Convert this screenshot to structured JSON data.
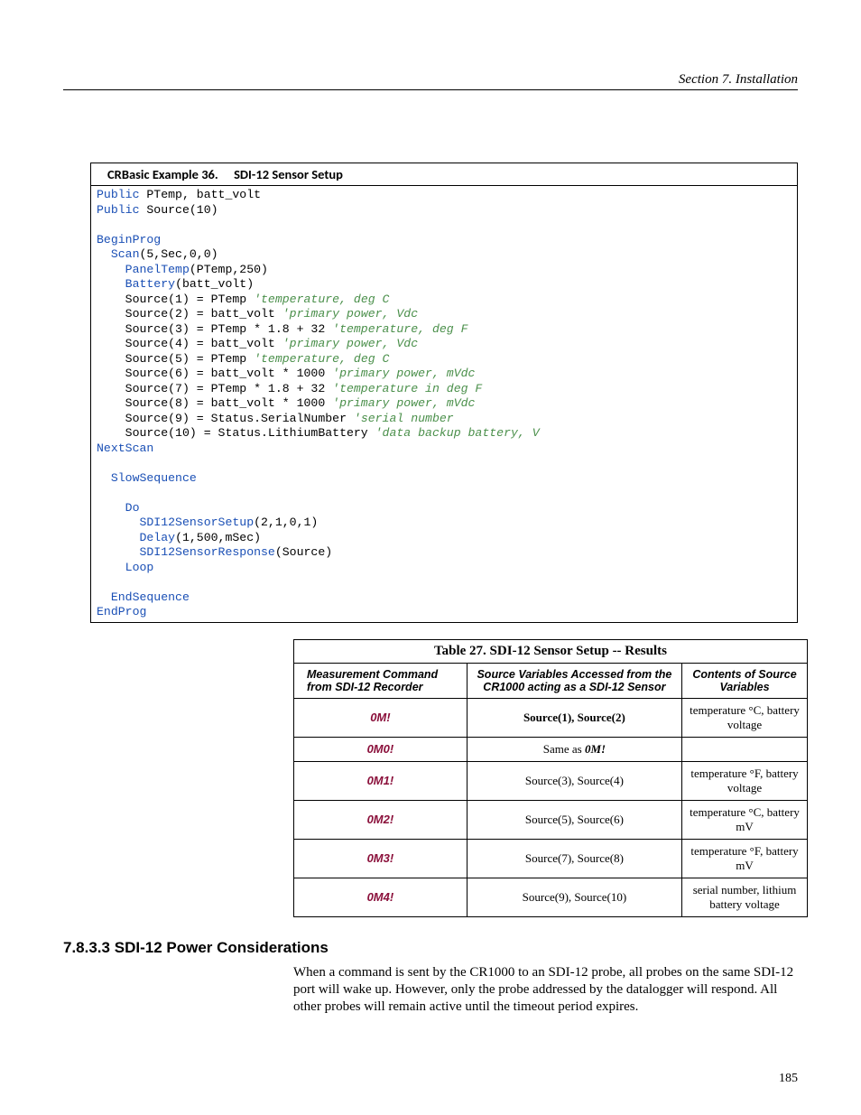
{
  "header": {
    "section": "Section 7.  Installation"
  },
  "example": {
    "label": "CRBasic Example 36.",
    "title": "SDI-12 Sensor Setup"
  },
  "code": {
    "l1a": "Public",
    "l1b": " PTemp, batt_volt",
    "l2a": "Public",
    "l2b": " Source(10)",
    "l3": "BeginProg",
    "l4a": "Scan",
    "l4b": "(5,Sec,0,0)",
    "l5a": "PanelTemp",
    "l5b": "(PTemp,250)",
    "l6a": "Battery",
    "l6b": "(batt_volt)",
    "l7a": "    Source(1) = PTemp ",
    "l7c": "'temperature, deg C",
    "l8a": "    Source(2) = batt_volt ",
    "l8c": "'primary power, Vdc",
    "l9a": "    Source(3) = PTemp * 1.8 + 32 ",
    "l9c": "'temperature, deg F",
    "l10a": "    Source(4) = batt_volt ",
    "l10c": "'primary power, Vdc",
    "l11a": "    Source(5) = PTemp ",
    "l11c": "'temperature, deg C",
    "l12a": "    Source(6) = batt_volt * 1000 ",
    "l12c": "'primary power, mVdc",
    "l13a": "    Source(7) = PTemp * 1.8 + 32 ",
    "l13c": "'temperature in deg F",
    "l14a": "    Source(8) = batt_volt * 1000 ",
    "l14c": "'primary power, mVdc",
    "l15a": "    Source(9) = Status.SerialNumber ",
    "l15c": "'serial number",
    "l16a": "    Source(10) = Status.LithiumBattery ",
    "l16c": "'data backup battery, V",
    "l17": "NextScan",
    "l18": "SlowSequence",
    "l19": "Do",
    "l20a": "SDI12SensorSetup",
    "l20b": "(2,1,0,1)",
    "l21a": "Delay",
    "l21b": "(1,500,mSec)",
    "l22a": "SDI12SensorResponse",
    "l22b": "(Source)",
    "l23": "Loop",
    "l24": "EndSequence",
    "l25": "EndProg"
  },
  "table": {
    "title": "Table 27. SDI-12 Sensor Setup -- Results",
    "headers": {
      "c1": "Measurement Command from SDI-12 Recorder",
      "c2": "Source Variables Accessed from the CR1000 acting as a SDI-12 Sensor",
      "c3": "Contents of Source Variables"
    },
    "rows": [
      {
        "cmd": "0M!",
        "src": "Source(1), Source(2)",
        "cont": "temperature °C, battery voltage"
      },
      {
        "cmd": "0M0!",
        "src_prefix": "Same as ",
        "src_em": "0M!",
        "cont": ""
      },
      {
        "cmd": "0M1!",
        "src": "Source(3), Source(4)",
        "cont": "temperature °F, battery voltage"
      },
      {
        "cmd": "0M2!",
        "src": "Source(5), Source(6)",
        "cont": "temperature °C, battery mV"
      },
      {
        "cmd": "0M3!",
        "src": "Source(7), Source(8)",
        "cont": "temperature °F, battery mV"
      },
      {
        "cmd": "0M4!",
        "src": "Source(9), Source(10)",
        "cont": "serial number, lithium battery voltage"
      }
    ]
  },
  "section": {
    "num": "7.8.3.3",
    "title": "SDI-12 Power Considerations",
    "body": "When a command is sent by the CR1000 to an SDI-12 probe, all probes on the same SDI-12 port will wake up. However, only the probe addressed by the datalogger will respond.  All other probes will remain active until the timeout period expires."
  },
  "page_number": "185"
}
